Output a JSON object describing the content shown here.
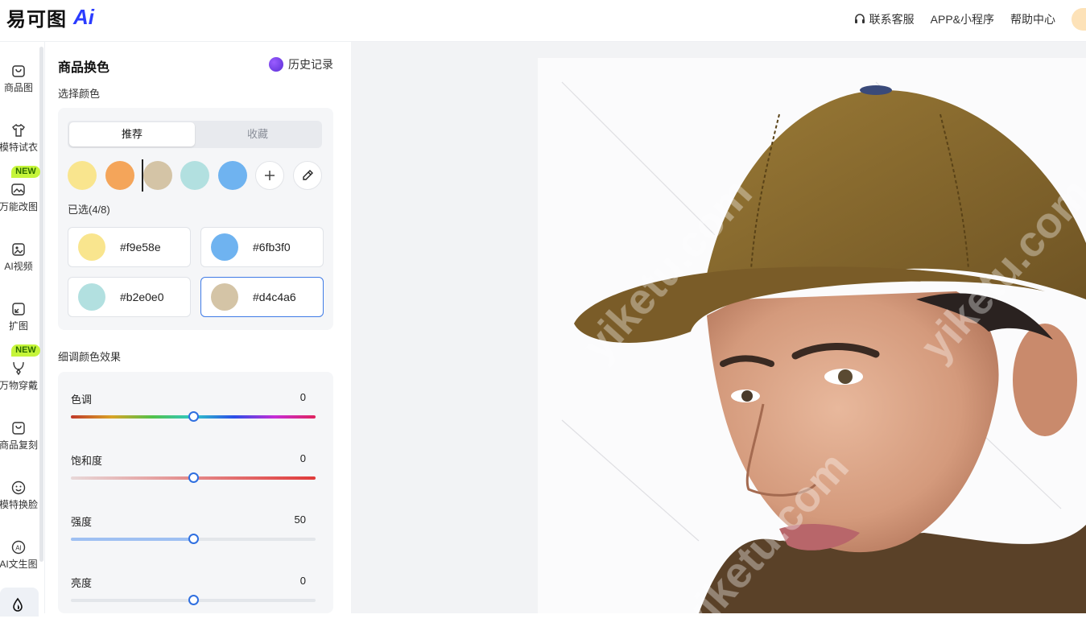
{
  "header": {
    "logo_text": "易可图",
    "logo_ai": "Ai",
    "links": [
      "联系客服",
      "APP&小程序",
      "帮助中心"
    ]
  },
  "nav": {
    "items": [
      {
        "label": "商品图",
        "icon": "bag-icon"
      },
      {
        "label": "模特试衣",
        "icon": "tshirt-icon"
      },
      {
        "label": "万能改图",
        "icon": "image-edit-icon",
        "badge": "NEW"
      },
      {
        "label": "AI视频",
        "icon": "video-icon"
      },
      {
        "label": "扩图",
        "icon": "expand-image-icon"
      },
      {
        "label": "万物穿戴",
        "icon": "necklace-icon",
        "badge": "NEW"
      },
      {
        "label": "商品复刻",
        "icon": "bag-copy-icon"
      },
      {
        "label": "模特换脸",
        "icon": "face-icon"
      },
      {
        "label": "AI文生图",
        "icon": "ai-text-image-icon"
      }
    ]
  },
  "panel": {
    "title": "商品换色",
    "history": "历史记录",
    "choose_color": "选择颜色",
    "tabs": [
      "推荐",
      "收藏"
    ],
    "active_tab": "推荐",
    "swatches": [
      "#f9e58e",
      "#f4a55a",
      "#d4c4a6",
      "#b2e0e0",
      "#6fb3f0"
    ],
    "selected_label": "已选(4/8)",
    "selected_colors": [
      {
        "hex": "#f9e58e",
        "label": "#f9e58e"
      },
      {
        "hex": "#6fb3f0",
        "label": "#6fb3f0"
      },
      {
        "hex": "#b2e0e0",
        "label": "#b2e0e0"
      },
      {
        "hex": "#d4c4a6",
        "label": "#d4c4a6"
      }
    ],
    "selected_chip": "#d4c4a6",
    "fine_tune": "细调颜色效果",
    "sliders": [
      {
        "label": "色调",
        "value": "0",
        "level": 0.5
      },
      {
        "label": "饱和度",
        "value": "0",
        "level": 0.5
      },
      {
        "label": "强度",
        "value": "50",
        "level": 0.5
      },
      {
        "label": "亮度",
        "value": "0",
        "level": 0.5
      }
    ]
  },
  "canvas": {
    "watermark": "yiketu.com"
  },
  "colors": {
    "accent": "#2f6fe0",
    "badge": "#c5f53a",
    "cap": "#8a6a2a"
  }
}
